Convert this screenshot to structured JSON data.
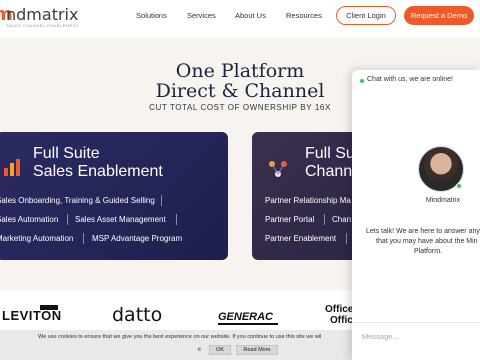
{
  "brand": {
    "logo_text": "ndmatrix",
    "logo_sub": "SALES CHANNEL ENABLEMENT"
  },
  "nav": [
    "Solutions",
    "Services",
    "About Us",
    "Resources"
  ],
  "header": {
    "client_login": "Client Login",
    "request_demo": "Request a Demo"
  },
  "hero": {
    "title_line1": "One Platform",
    "title_line2": "Direct & Channel",
    "tagline": "CUT TOTAL COST OF OWNERSHIP BY 16X"
  },
  "cards": {
    "left": {
      "title_line1": "Full Suite",
      "title_line2": "Sales Enablement",
      "features": [
        "Sales Onboarding, Training & Guided Selling",
        "Sales Automation",
        "Sales Asset Management",
        "Marketing Automation",
        "MSP Advantage Program"
      ]
    },
    "right": {
      "title_line1": "Full Su",
      "title_line2": "Chann",
      "features": [
        "Partner Relationship Ma",
        "Partner Portal",
        "Chan",
        "Partner Enablement"
      ]
    }
  },
  "partner_logos": [
    "LEVITON",
    "datto",
    "GENERAC",
    "Office",
    "Office"
  ],
  "cookie": {
    "text": "We use cookies to ensure that we give you the best experience on our website. If you continue to use this site we wil",
    "suffix": "it",
    "ok": "OK",
    "read_more": "Read More"
  },
  "chat": {
    "status": "Chat with us, we are online!",
    "agent": "Mindmatrix",
    "message": [
      "Lets talk! We are here to answer any",
      "that you may have about the Min",
      "Platform."
    ],
    "input_placeholder": "Message..."
  },
  "colors": {
    "accent": "#ef5a2b",
    "card": "#2b2b63",
    "online": "#3cc35e"
  }
}
